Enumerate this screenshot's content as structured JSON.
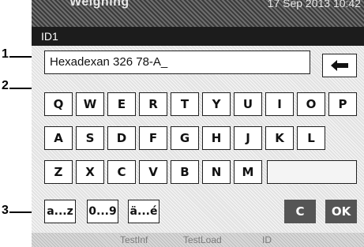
{
  "callouts": [
    "1",
    "2",
    "3"
  ],
  "topbar": {
    "app_title": "Weighing",
    "datetime": "17 Sep 2013 10:42"
  },
  "titlebar": {
    "title": "ID1"
  },
  "input": {
    "value": "Hexadexan 326 78-A_"
  },
  "keyboard": {
    "row1": [
      "Q",
      "W",
      "E",
      "R",
      "T",
      "Y",
      "U",
      "I",
      "O",
      "P"
    ],
    "row2": [
      "A",
      "S",
      "D",
      "F",
      "G",
      "H",
      "J",
      "K",
      "L"
    ],
    "row3": [
      "Z",
      "X",
      "C",
      "V",
      "B",
      "N",
      "M"
    ],
    "row4": {
      "lowercase": "a...z",
      "numbers": "0...9",
      "special": "ä...é",
      "clear": "C",
      "ok": "OK"
    }
  },
  "backspace_icon": "arrow-left-icon",
  "footer": [
    "TestInf",
    "TestLoad",
    "ID"
  ]
}
